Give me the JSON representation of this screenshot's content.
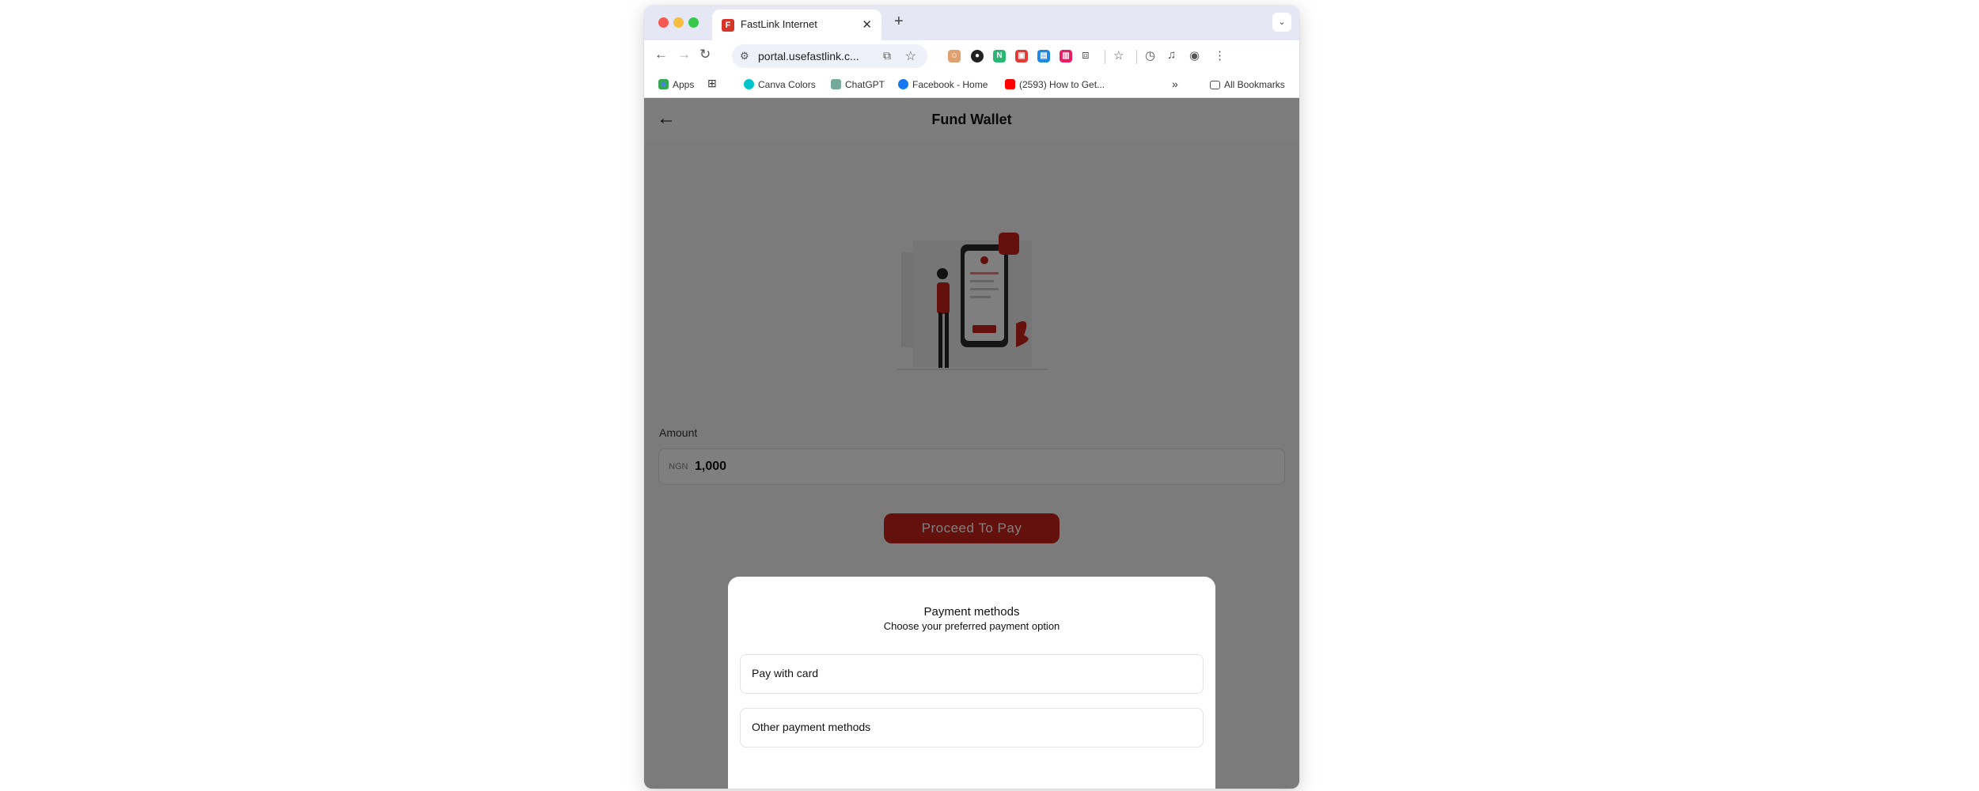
{
  "browser": {
    "tab_title": "FastLink Internet",
    "tab_favicon_letter": "F",
    "url": "portal.usefastlink.c...",
    "bookmarks": [
      {
        "label": "Apps"
      },
      {
        "label": "Canva Colors"
      },
      {
        "label": "ChatGPT"
      },
      {
        "label": "Facebook - Home"
      },
      {
        "label": "(2593) How to Get..."
      }
    ],
    "all_bookmarks": "All Bookmarks",
    "overflow": "»"
  },
  "page": {
    "title": "Fund Wallet",
    "amount_label": "Amount",
    "currency": "NGN",
    "amount_value": "1,000",
    "proceed_label": "Proceed To Pay"
  },
  "modal": {
    "title": "Payment methods",
    "subtitle": "Choose your preferred payment option",
    "options": [
      {
        "label": "Pay with card"
      },
      {
        "label": "Other payment methods"
      }
    ]
  },
  "colors": {
    "brand": "#c8201a",
    "tabstrip": "#e6e7f5"
  }
}
